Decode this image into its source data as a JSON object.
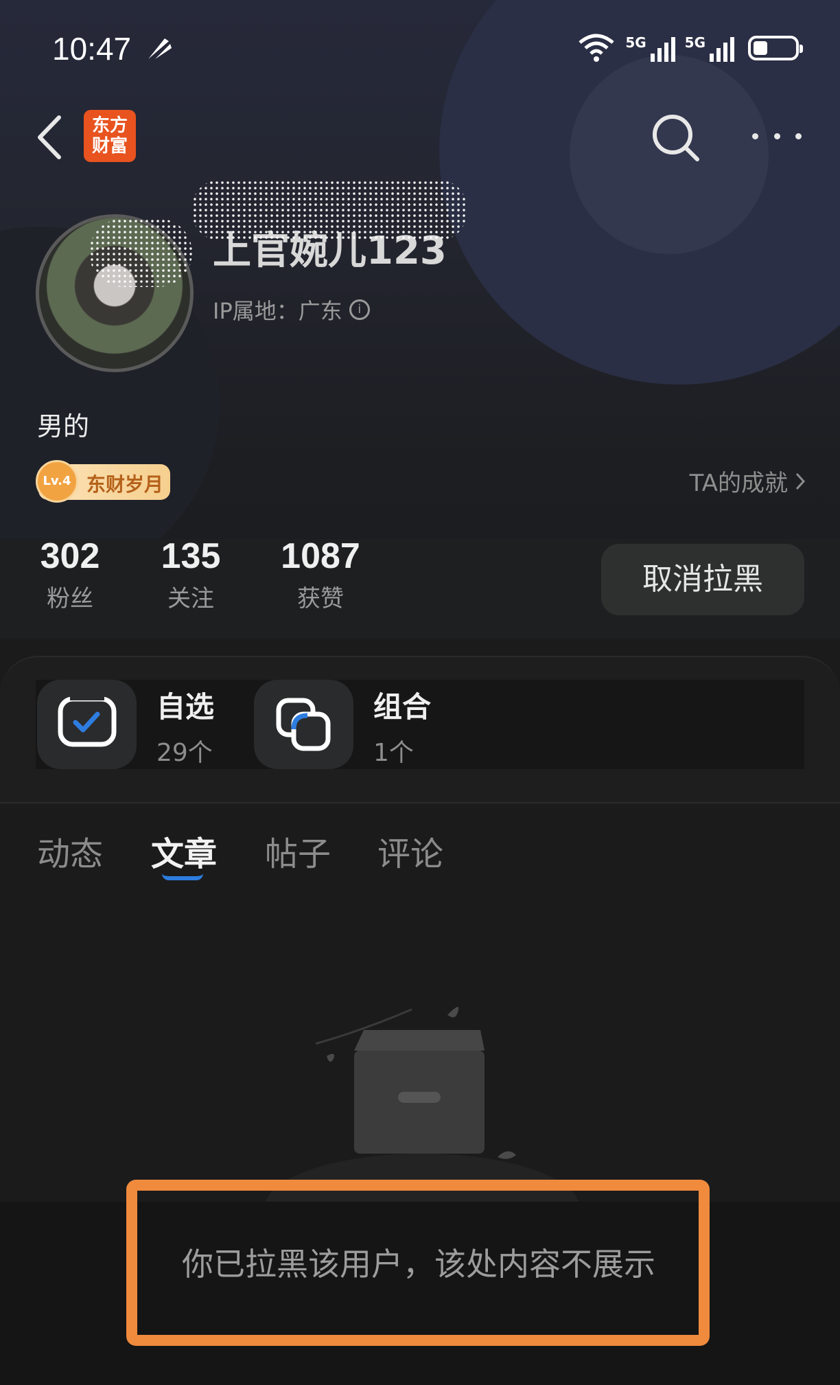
{
  "status_bar": {
    "time": "10:47",
    "network_1": "5G",
    "network_2": "5G"
  },
  "nav": {
    "logo_text": "东方财富",
    "logo_line1": "东方",
    "logo_line2": "财富"
  },
  "profile": {
    "username": "上官婉儿123",
    "ip_location": "IP属地：广东",
    "bio": "男的",
    "badge_level": "Lv.4",
    "badge_label": "东财岁月",
    "achievements_link": "TA的成就"
  },
  "stats": [
    {
      "value": "302",
      "label": "粉丝"
    },
    {
      "value": "135",
      "label": "关注"
    },
    {
      "value": "1087",
      "label": "获赞"
    }
  ],
  "unblock_label": "取消拉黑",
  "tools": [
    {
      "title": "自选",
      "count": "29个"
    },
    {
      "title": "组合",
      "count": "1个"
    }
  ],
  "tabs": [
    {
      "label": "动态",
      "active": false
    },
    {
      "label": "文章",
      "active": true
    },
    {
      "label": "帖子",
      "active": false
    },
    {
      "label": "评论",
      "active": false
    }
  ],
  "notice": "你已拉黑该用户，该处内容不展示",
  "colors": {
    "accent_blue": "#2e7de0",
    "highlight_orange": "#f08a3d",
    "logo_orange": "#e8531f"
  }
}
